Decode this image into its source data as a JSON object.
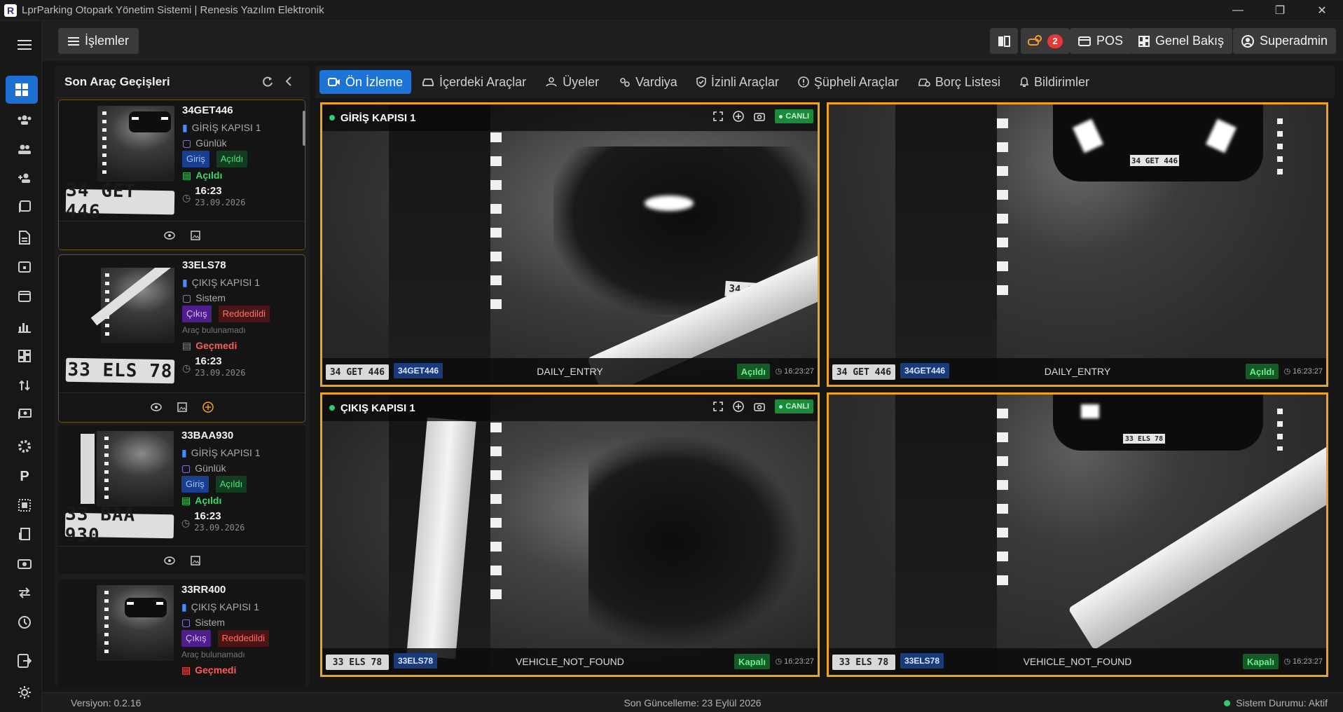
{
  "window": {
    "title": "LprParking Otopark Yönetim Sistemi | Renesis Yazılım Elektronik",
    "logo": "R"
  },
  "topbar": {
    "operations_label": "İşlemler",
    "alert_count": "2",
    "pos_label": "POS",
    "overview_label": "Genel Bakış",
    "user_label": "Superadmin"
  },
  "left_panel": {
    "title": "Son Araç Geçişleri",
    "cards": [
      {
        "plate": "34GET446",
        "plate_image": "34 GET 446",
        "gate": "GİRİŞ KAPISI 1",
        "type": "Günlük",
        "direction": "Giriş",
        "status": "Açıldı",
        "result": "Açıldı",
        "note": "",
        "time": "16:23",
        "date": "23.09.2026"
      },
      {
        "plate": "33ELS78",
        "plate_image": "33 ELS 78",
        "gate": "ÇIKIŞ KAPISI 1",
        "type": "Sistem",
        "direction": "Çıkış",
        "status": "Reddedildi",
        "result": "Geçmedi",
        "note": "Araç bulunamadı",
        "time": "16:23",
        "date": "23.09.2026"
      },
      {
        "plate": "33BAA930",
        "plate_image": "33 BAA 930",
        "gate": "GİRİŞ KAPISI 1",
        "type": "Günlük",
        "direction": "Giriş",
        "status": "Açıldı",
        "result": "Açıldı",
        "note": "",
        "time": "16:23",
        "date": "23.09.2026"
      },
      {
        "plate": "33RR400",
        "plate_image": "",
        "gate": "ÇIKIŞ KAPISI 1",
        "type": "Sistem",
        "direction": "Çıkış",
        "status": "Reddedildi",
        "result": "Geçmedi",
        "note": "Araç bulunamadı",
        "time": "",
        "date": ""
      }
    ]
  },
  "tabs": [
    "Ön İzleme",
    "İçerdeki Araçlar",
    "Üyeler",
    "Vardiya",
    "İzinli Araçlar",
    "Şüpheli Araçlar",
    "Borç Listesi",
    "Bildirimler"
  ],
  "cameras": [
    {
      "title": "GİRİŞ KAPISI 1",
      "live": "CANLI",
      "plate_image": "34 GET 446",
      "plate": "34GET446",
      "event": "DAILY_ENTRY",
      "status": "Açıldı",
      "time": "16:23:27"
    },
    {
      "title": "",
      "live": "",
      "plate_image": "34 GET 446",
      "plate": "34GET446",
      "event": "DAILY_ENTRY",
      "status": "Açıldı",
      "time": "16:23:27"
    },
    {
      "title": "ÇIKIŞ KAPISI 1",
      "live": "CANLI",
      "plate_image": "33 ELS 78",
      "plate": "33ELS78",
      "event": "VEHICLE_NOT_FOUND",
      "status": "Kapalı",
      "time": "16:23:27"
    },
    {
      "title": "",
      "live": "",
      "plate_image": "33 ELS 78",
      "plate": "33ELS78",
      "event": "VEHICLE_NOT_FOUND",
      "status": "Kapalı",
      "time": "16:23:27"
    }
  ],
  "footer": {
    "version": "Versiyon: 0.2.16",
    "update": "Son Güncelleme: 23 Eylül 2026",
    "system_status": "Sistem Durumu: Aktif"
  },
  "colors": {
    "accent": "#1d73d6",
    "camera_border": "#f0a21a",
    "live_green": "#2ecc71"
  }
}
